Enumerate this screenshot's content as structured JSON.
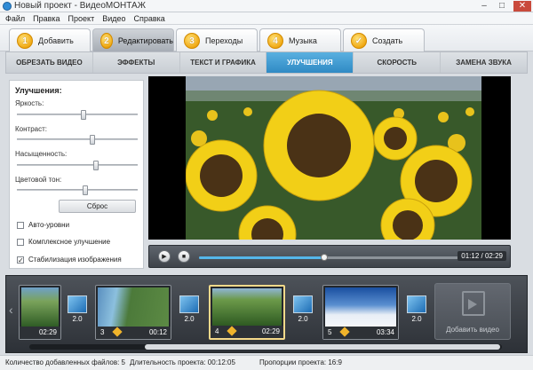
{
  "window": {
    "title": "Новый проект - ВидеоМОНТАЖ",
    "min": "–",
    "max": "□",
    "close": "✕"
  },
  "menu": [
    "Файл",
    "Правка",
    "Проект",
    "Видео",
    "Справка"
  ],
  "steps": [
    {
      "num": "1",
      "label": "Добавить"
    },
    {
      "num": "2",
      "label": "Редактировать",
      "active": true
    },
    {
      "num": "3",
      "label": "Переходы"
    },
    {
      "num": "4",
      "label": "Музыка"
    },
    {
      "num": "✓",
      "label": "Создать"
    }
  ],
  "subtabs": [
    {
      "label": "ОБРЕЗАТЬ ВИДЕО"
    },
    {
      "label": "ЭФФЕКТЫ"
    },
    {
      "label": "ТЕКСТ И ГРАФИКА"
    },
    {
      "label": "УЛУЧШЕНИЯ",
      "active": true
    },
    {
      "label": "СКОРОСТЬ"
    },
    {
      "label": "ЗАМЕНА ЗВУКА"
    }
  ],
  "enhance": {
    "title": "Улучшения:",
    "brightness": {
      "label": "Яркость:",
      "value": 0.55
    },
    "contrast": {
      "label": "Контраст:",
      "value": 0.63
    },
    "saturation": {
      "label": "Насыщенность:",
      "value": 0.66
    },
    "hue": {
      "label": "Цветовой тон:",
      "value": 0.57
    },
    "reset": "Сброс",
    "auto_levels": {
      "label": "Авто-уровни",
      "checked": false
    },
    "complex": {
      "label": "Комплексное улучшение",
      "checked": false
    },
    "stabilize": {
      "label": "Стабилизация изображения",
      "checked": true
    }
  },
  "player": {
    "play": "▶",
    "stop": "■",
    "time": "01:12 / 02:29",
    "progress": 0.48
  },
  "timeline": {
    "clips": [
      {
        "num": "",
        "dur": "02:29"
      },
      {
        "num": "3",
        "dur": "00:12"
      },
      {
        "num": "4",
        "dur": "02:29",
        "active": true
      },
      {
        "num": "5",
        "dur": "03:34"
      }
    ],
    "transitions": [
      "2.0",
      "2.0",
      "2.0",
      "2.0"
    ],
    "add_video": "Добавить видео",
    "arrow": "‹"
  },
  "status": {
    "files": "Количество добавленных файлов: 5",
    "duration": "Длительность проекта: 00:12:05",
    "ratio": "Пропорции проекта: 16:9"
  }
}
